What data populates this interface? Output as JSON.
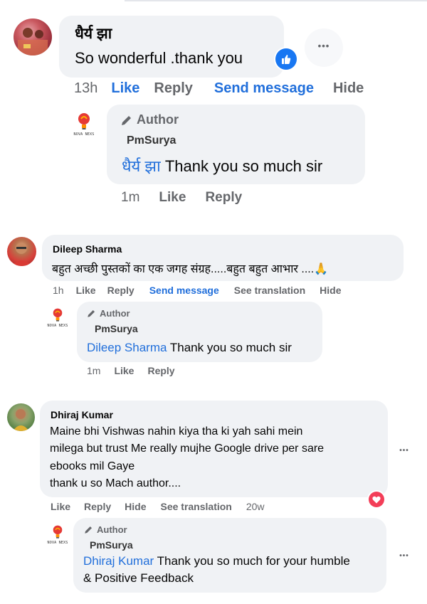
{
  "comments": [
    {
      "author": "धैर्य झा",
      "text": "So wonderful .thank you",
      "reaction_icon": "like-thumbs-up-icon",
      "more_icon": "more-dots-icon",
      "actions": {
        "time": "13h",
        "like": "Like",
        "reply": "Reply",
        "send_message": "Send message",
        "hide": "Hide"
      },
      "reply": {
        "author_tag": "Author",
        "author_tag_icon": "pencil-icon",
        "page_name": "PmSurya",
        "logo_label": "NOVA NEXS",
        "mention": "धैर्य झा",
        "text": " Thank you so much sir",
        "actions": {
          "time": "1m",
          "like": "Like",
          "reply": "Reply"
        }
      }
    },
    {
      "author": "Dileep Sharma",
      "text": "बहुत अच्छी पुस्तकों का एक जगह संग्रह.....बहुत बहुत आभार ....🙏",
      "actions": {
        "time": "1h",
        "like": "Like",
        "reply": "Reply",
        "send_message": "Send message",
        "see_translation": "See translation",
        "hide": "Hide"
      },
      "reply": {
        "author_tag": "Author",
        "author_tag_icon": "pencil-icon",
        "page_name": "PmSurya",
        "logo_label": "NOVA NEXS",
        "mention": "Dileep Sharma",
        "text": " Thank you so much sir",
        "actions": {
          "time": "1m",
          "like": "Like",
          "reply": "Reply"
        }
      }
    },
    {
      "author": "Dhiraj Kumar",
      "text_lines": [
        "Maine bhi Vishwas nahin kiya tha ki yah sahi mein",
        "milega but trust Me really mujhe Google drive per sare",
        "ebooks mil Gaye",
        "thank u so Mach author...."
      ],
      "reaction_icon": "love-heart-icon",
      "more_icon": "more-dots-icon",
      "actions": {
        "like": "Like",
        "reply": "Reply",
        "hide": "Hide",
        "see_translation": "See translation",
        "time": "20w"
      },
      "reply": {
        "author_tag": "Author",
        "author_tag_icon": "pencil-icon",
        "page_name": "PmSurya",
        "logo_label": "NOVA NEXS",
        "mention": "Dhiraj Kumar",
        "text_line1": " Thank you so much for your humble",
        "text_line2": "& Positive Feedback",
        "actions": {}
      }
    }
  ],
  "more_dots_label": "•••",
  "colors": {
    "bubble": "#f0f2f5",
    "link_blue": "#216fdb",
    "muted": "#65676b",
    "like_blue": "#1877f2",
    "love_red": "#f33e58"
  }
}
